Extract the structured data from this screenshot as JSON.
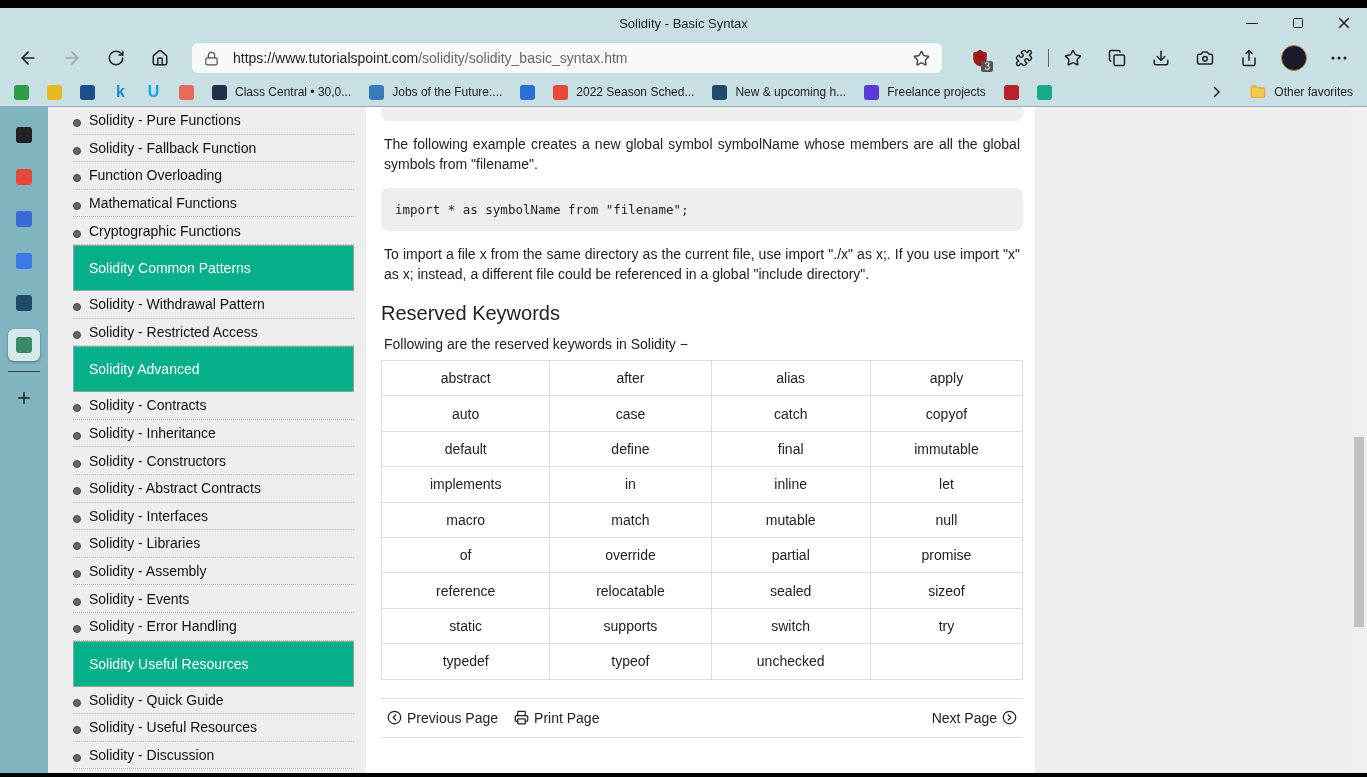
{
  "window": {
    "title": "Solidity - Basic Syntax"
  },
  "address_bar": {
    "url_host": "https://www.tutorialspoint.com",
    "url_path": "/solidity/solidity_basic_syntax.htm"
  },
  "extension_badge": "3",
  "bookmarks": [
    {
      "kind": "icon",
      "color": "#2e9c4a"
    },
    {
      "kind": "icon",
      "color": "#e8b820"
    },
    {
      "kind": "icon",
      "color": "#1a4f8a"
    },
    {
      "kind": "text-icon",
      "glyph": "k",
      "color": "#1a8ad6"
    },
    {
      "kind": "text-icon",
      "glyph": "U",
      "color": "#1aa3e8"
    },
    {
      "kind": "icon",
      "color": "#e86a5a"
    },
    {
      "kind": "labeled",
      "label": "Class Central • 30,0...",
      "color": "#1f2f4a"
    },
    {
      "kind": "labeled",
      "label": "Jobs of the Future:...",
      "color": "#3a7ab8"
    },
    {
      "kind": "icon",
      "color": "#2a6fd6"
    },
    {
      "kind": "labeled",
      "label": "2022 Season Sched...",
      "color": "#e84a3a"
    },
    {
      "kind": "labeled",
      "label": "New & upcoming h...",
      "color": "#1f4a6a"
    },
    {
      "kind": "labeled",
      "label": "Freelance projects",
      "color": "#5a3ad6"
    },
    {
      "kind": "icon",
      "color": "#b8222a"
    },
    {
      "kind": "icon",
      "color": "#1aa88a"
    }
  ],
  "other_favorites": "Other favorites",
  "side_icons": [
    {
      "color": "#222222",
      "selected": false
    },
    {
      "color": "#e84a3a",
      "selected": false
    },
    {
      "color": "#3a6ad6",
      "selected": false
    },
    {
      "color": "#3a7ae8",
      "selected": false
    },
    {
      "color": "#1f4a6a",
      "selected": false
    },
    {
      "color": "#3a8a6a",
      "selected": true
    }
  ],
  "nav": [
    {
      "kind": "item",
      "label": "Solidity - Pure Functions"
    },
    {
      "kind": "item",
      "label": "Solidity - Fallback Function"
    },
    {
      "kind": "item",
      "label": "Function Overloading"
    },
    {
      "kind": "item",
      "label": "Mathematical Functions"
    },
    {
      "kind": "item",
      "label": "Cryptographic Functions"
    },
    {
      "kind": "heading",
      "label": "Solidity Common Patterns"
    },
    {
      "kind": "item",
      "label": "Solidity - Withdrawal Pattern"
    },
    {
      "kind": "item",
      "label": "Solidity - Restricted Access"
    },
    {
      "kind": "heading",
      "label": "Solidity Advanced"
    },
    {
      "kind": "item",
      "label": "Solidity - Contracts"
    },
    {
      "kind": "item",
      "label": "Solidity - Inheritance"
    },
    {
      "kind": "item",
      "label": "Solidity - Constructors"
    },
    {
      "kind": "item",
      "label": "Solidity - Abstract Contracts"
    },
    {
      "kind": "item",
      "label": "Solidity - Interfaces"
    },
    {
      "kind": "item",
      "label": "Solidity - Libraries"
    },
    {
      "kind": "item",
      "label": "Solidity - Assembly"
    },
    {
      "kind": "item",
      "label": "Solidity - Events"
    },
    {
      "kind": "item",
      "label": "Solidity - Error Handling"
    },
    {
      "kind": "heading",
      "label": "Solidity Useful Resources"
    },
    {
      "kind": "item",
      "label": "Solidity - Quick Guide"
    },
    {
      "kind": "item",
      "label": "Solidity - Useful Resources"
    },
    {
      "kind": "item",
      "label": "Solidity - Discussion"
    }
  ],
  "content": [
    {
      "kind": "code-end"
    },
    {
      "kind": "paragraph",
      "text": "The following example creates a new global symbol symbolName whose members are all the global symbols from \"filename\"."
    },
    {
      "kind": "code",
      "text": "import * as symbolName from \"filename\";"
    },
    {
      "kind": "paragraph",
      "text": "To import a file x from the same directory as the current file, use import \"./x\" as x;. If you use import \"x\" as x; instead, a different file could be referenced in a global \"include directory\"."
    },
    {
      "kind": "heading",
      "text": "Reserved Keywords"
    },
    {
      "kind": "intro",
      "text": "Following are the reserved keywords in Solidity −"
    }
  ],
  "keywords": [
    [
      "abstract",
      "after",
      "alias",
      "apply"
    ],
    [
      "auto",
      "case",
      "catch",
      "copyof"
    ],
    [
      "default",
      "define",
      "final",
      "immutable"
    ],
    [
      "implements",
      "in",
      "inline",
      "let"
    ],
    [
      "macro",
      "match",
      "mutable",
      "null"
    ],
    [
      "of",
      "override",
      "partial",
      "promise"
    ],
    [
      "reference",
      "relocatable",
      "sealed",
      "sizeof"
    ],
    [
      "static",
      "supports",
      "switch",
      "try"
    ],
    [
      "typedef",
      "typeof",
      "unchecked"
    ]
  ],
  "pager": {
    "previous": "Previous Page",
    "print": "Print Page",
    "next": "Next Page"
  }
}
